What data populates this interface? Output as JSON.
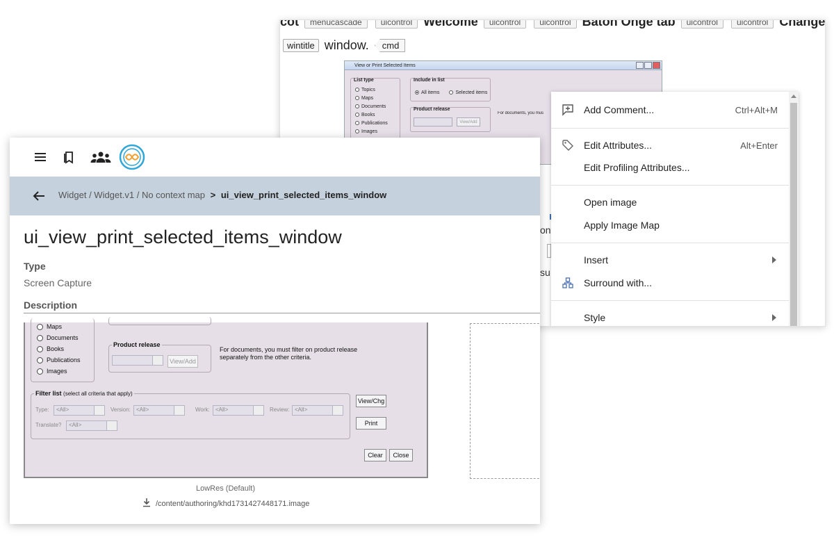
{
  "editor": {
    "line1_tags": [
      "menucascade",
      "uicontrol",
      "uicontrol",
      "uicontrol",
      "uicontrol",
      "uicontrol"
    ],
    "line1_words": [
      "Welcome",
      "Baton Onge tab",
      "Change"
    ],
    "line2": {
      "wintitle": "wintitle",
      "text": "window.",
      "cmd": "cmd"
    },
    "fragments": {
      "ont": "ont",
      "su": "su"
    }
  },
  "small_dialog": {
    "title": "View or Print Selected Items",
    "list_type_label": "List type",
    "list_types": [
      "Topics",
      "Maps",
      "Documents",
      "Books",
      "Publications",
      "Images"
    ],
    "include_label": "Include in list",
    "include_options": [
      "All items",
      "Selected items"
    ],
    "product_release_label": "Product release",
    "view_add": "View/Add",
    "note": "For documents, you must filter on product release separately from the other criteria."
  },
  "context_menu": {
    "items": [
      {
        "label": "Add Comment...",
        "shortcut": "Ctrl+Alt+M",
        "icon": "add-comment-icon"
      },
      {
        "label": "Edit Attributes...",
        "shortcut": "Alt+Enter",
        "icon": "tag-icon"
      },
      {
        "label": "Edit Profiling Attributes...",
        "shortcut": "",
        "icon": ""
      },
      {
        "label": "Open image",
        "shortcut": "",
        "icon": ""
      },
      {
        "label": "Apply Image Map",
        "shortcut": "",
        "icon": ""
      },
      {
        "label": "Insert",
        "shortcut": "",
        "icon": "",
        "submenu": true
      },
      {
        "label": "Surround with...",
        "shortcut": "",
        "icon": "surround-icon"
      },
      {
        "label": "Style",
        "shortcut": "",
        "icon": "",
        "submenu": true
      }
    ]
  },
  "viewer": {
    "toolbar_icons": [
      "menu-icon",
      "bookmarks-icon",
      "people-icon",
      "app-logo-icon"
    ],
    "breadcrumb": {
      "path": "Widget / Widget.v1 /",
      "context": "No context map",
      "separator": ">",
      "current": "ui_view_print_selected_items_window"
    },
    "title": "ui_view_print_selected_items_window",
    "type_label": "Type",
    "type_value": "Screen Capture",
    "description_label": "Description",
    "resolution": "LowRes (Default)",
    "path": "/content/authoring/khd1731427448171.image"
  },
  "big_dialog": {
    "list_types": [
      "Maps",
      "Documents",
      "Books",
      "Publications",
      "Images"
    ],
    "product_release_label": "Product release",
    "view_add": "View/Add",
    "note_line1": "For documents, you must filter on product release",
    "note_line2": "separately from the other criteria.",
    "filter_label": "Filter list",
    "filter_hint": "(select all criteria that apply)",
    "filters": [
      {
        "label": "Type:",
        "value": "<All>"
      },
      {
        "label": "Version:",
        "value": "<All>"
      },
      {
        "label": "Work:",
        "value": "<All>"
      },
      {
        "label": "Review:",
        "value": "<All>"
      },
      {
        "label": "Translate?",
        "value": "<All>"
      }
    ],
    "buttons": {
      "view_chg": "View/Chg",
      "print": "Print",
      "clear": "Clear",
      "close": "Close"
    }
  }
}
